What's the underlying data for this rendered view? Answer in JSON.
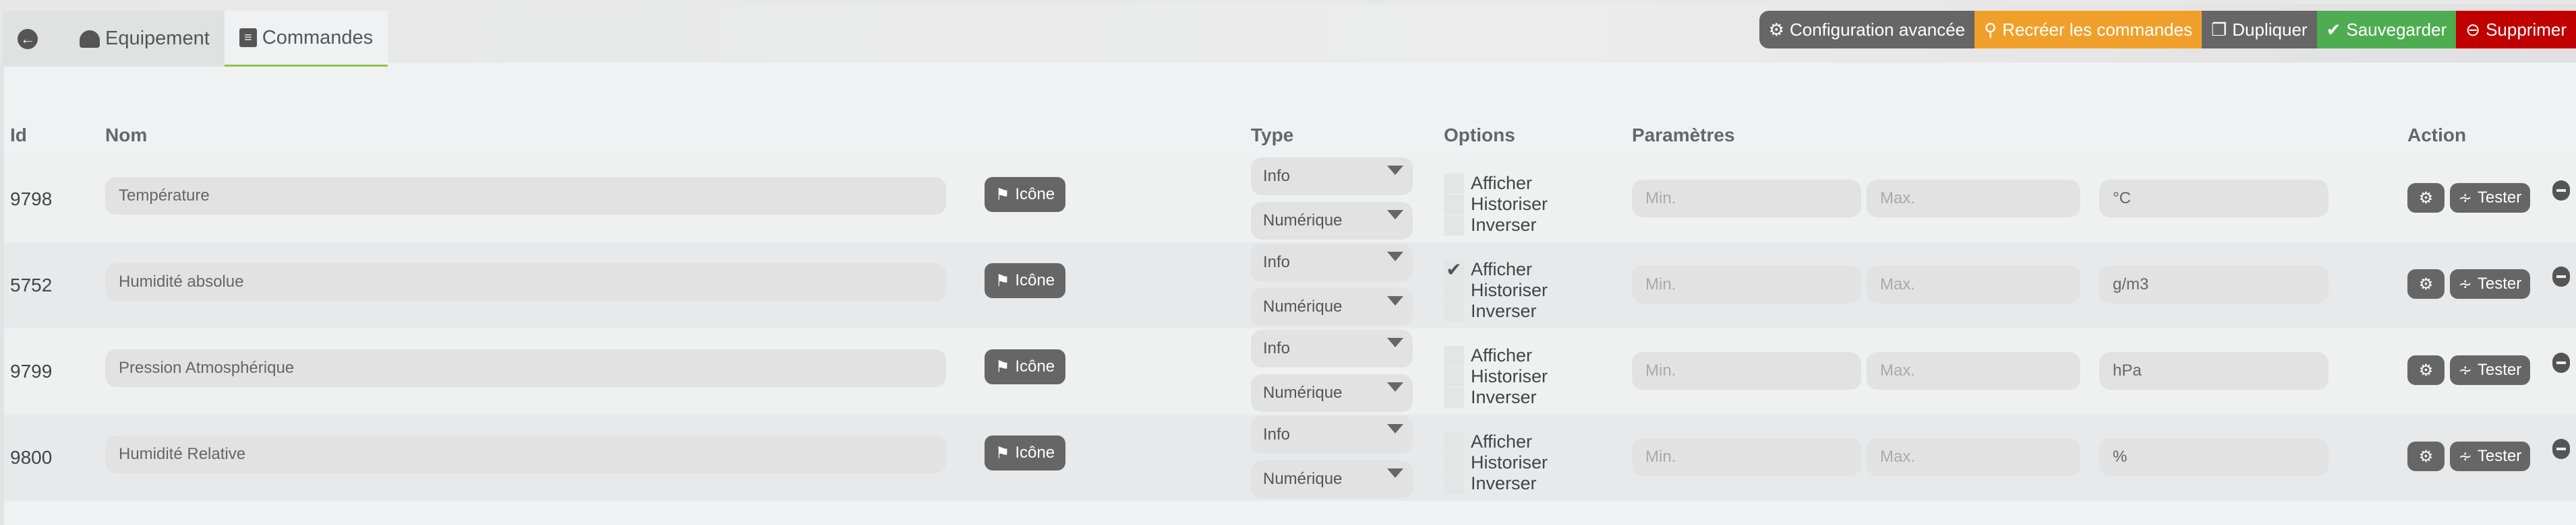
{
  "tabs": [
    {
      "label": "Equipement",
      "icon": "dashboard-icon"
    },
    {
      "label": "Commandes",
      "icon": "list-icon",
      "active": true
    }
  ],
  "toolbar": [
    {
      "label": "Configuration avancée",
      "icon": "gears-icon",
      "color": "#666666"
    },
    {
      "label": "Recréer les commandes",
      "icon": "search-icon",
      "color": "#f0a02a"
    },
    {
      "label": "Dupliquer",
      "icon": "copy-icon",
      "color": "#666666"
    },
    {
      "label": "Sauvegarder",
      "icon": "check-circle-icon",
      "color": "#4fad51"
    },
    {
      "label": "Supprimer",
      "icon": "minus-circle-icon",
      "color": "#c00000"
    }
  ],
  "columns": {
    "id": "Id",
    "nom": "Nom",
    "type": "Type",
    "options": "Options",
    "params": "Paramètres",
    "action": "Action"
  },
  "labels": {
    "icon_btn": "Icône",
    "afficher": "Afficher",
    "historiser": "Historiser",
    "inverser": "Inverser",
    "min": "Min.",
    "max": "Max.",
    "tester": "Tester"
  },
  "rows": [
    {
      "id": "9798",
      "name": "Température",
      "type": "Info",
      "subtype": "Numérique",
      "afficher": false,
      "historiser": false,
      "inverser": false,
      "unit": "°C"
    },
    {
      "id": "5752",
      "name": "Humidité absolue",
      "type": "Info",
      "subtype": "Numérique",
      "afficher": true,
      "historiser": false,
      "inverser": false,
      "unit": "g/m3"
    },
    {
      "id": "9799",
      "name": "Pression Atmosphérique",
      "type": "Info",
      "subtype": "Numérique",
      "afficher": false,
      "historiser": false,
      "inverser": false,
      "unit": "hPa"
    },
    {
      "id": "9800",
      "name": "Humidité Relative",
      "type": "Info",
      "subtype": "Numérique",
      "afficher": false,
      "historiser": false,
      "inverser": false,
      "unit": "%"
    }
  ]
}
